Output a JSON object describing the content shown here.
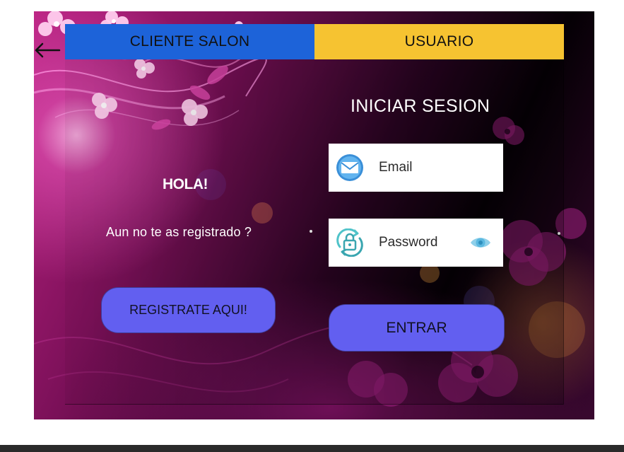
{
  "tabs": {
    "cliente_salon": "CLIENTE SALON",
    "usuario": "USUARIO"
  },
  "register_side": {
    "greeting": "HOLA!",
    "prompt": "Aun no te as registrado ?",
    "register_button": "REGISTRATE AQUI!"
  },
  "login": {
    "title": "INICIAR SESION",
    "email_placeholder": "Email",
    "email_icon": "envelope-icon",
    "password_placeholder": "Password",
    "password_icon": "lock-refresh-icon",
    "show_password_icon": "eye-icon",
    "submit_button": "ENTRAR"
  },
  "navigation": {
    "back_icon": "back-arrow-icon"
  },
  "colors": {
    "tab_cliente": "#1d63d9",
    "tab_usuario": "#f6c331",
    "button": "#625ff0",
    "accent_icon": "#5bb8e0"
  }
}
